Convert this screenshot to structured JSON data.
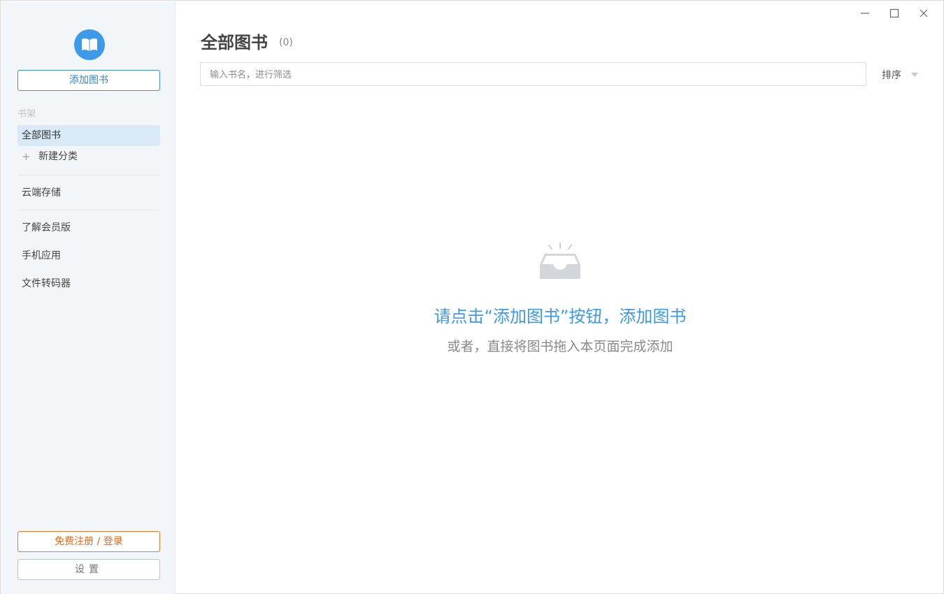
{
  "sidebar": {
    "add_book_label": "添加图书",
    "section_title": "书架",
    "items": [
      {
        "label": "全部图书"
      },
      {
        "label": "新建分类"
      },
      {
        "label": "云端存储"
      },
      {
        "label": "了解会员版"
      },
      {
        "label": "手机应用"
      },
      {
        "label": "文件转码器"
      }
    ],
    "login_label": "免费注册 / 登录",
    "settings_label": "设置"
  },
  "main": {
    "title": "全部图书",
    "count": "(0)",
    "search_placeholder": "输入书名，进行筛选",
    "search_value": "",
    "sort_label": "排序",
    "empty_title": "请点击“添加图书”按钮，添加图书",
    "empty_subtitle": "或者，直接将图书拖入本页面完成添加"
  },
  "colors": {
    "accent": "#3d9ae8",
    "login": "#e06b1f",
    "sidebar_bg": "#f3f6f9",
    "active_bg": "#d9e9f8"
  },
  "icons": {
    "logo": "open-book-icon",
    "plus": "plus-icon",
    "sort_caret": "caret-down-icon",
    "empty": "empty-inbox-icon",
    "minimize": "minimize-icon",
    "maximize": "maximize-icon",
    "close": "close-icon"
  }
}
